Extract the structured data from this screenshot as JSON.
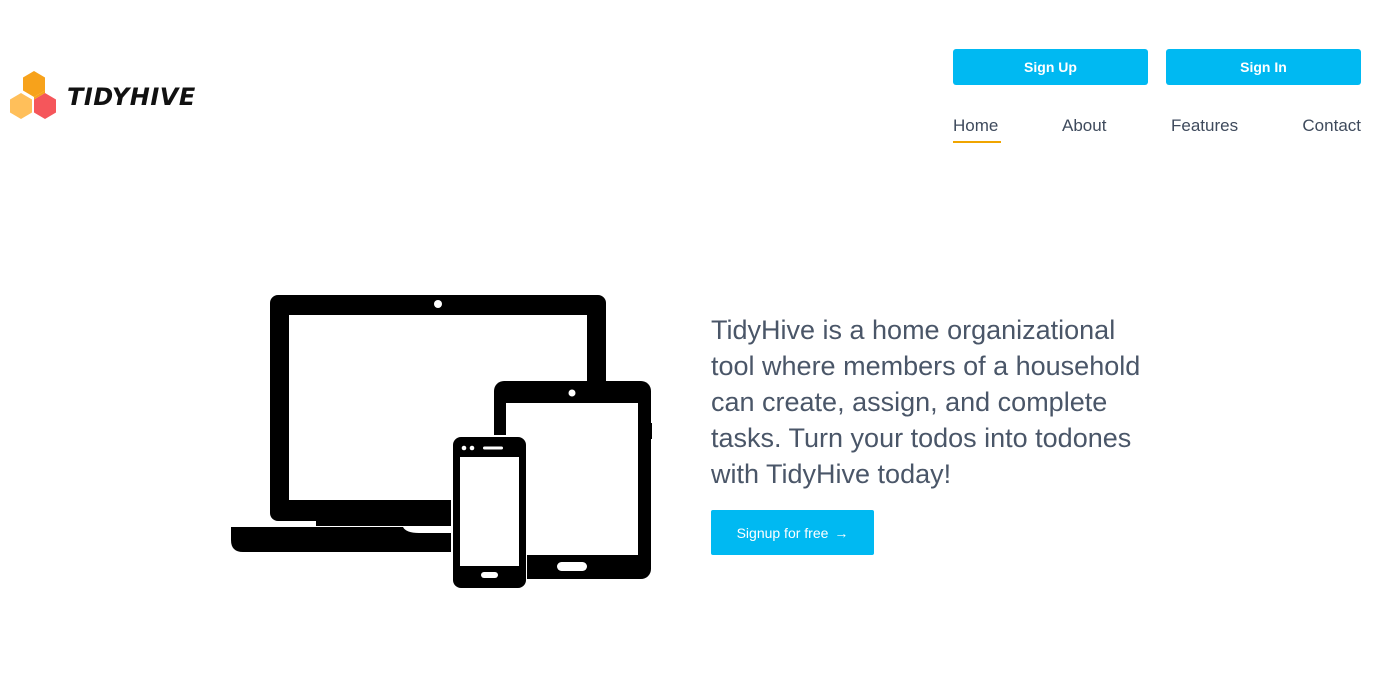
{
  "brand": {
    "name": "TIDYHIVE",
    "hex_colors": [
      "#f7a21b",
      "#ffbf5a",
      "#f5565b"
    ]
  },
  "header": {
    "signup_label": "Sign Up",
    "signin_label": "Sign In",
    "button_color": "#00b9f2"
  },
  "nav": {
    "items": [
      {
        "label": "Home",
        "active": true
      },
      {
        "label": "About",
        "active": false
      },
      {
        "label": "Features",
        "active": false
      },
      {
        "label": "Contact",
        "active": false
      }
    ],
    "active_underline_color": "#f0a500"
  },
  "hero": {
    "description": "TidyHive is a home organizational tool where members of a household can create, assign, and complete tasks. Turn your todos into todones with TidyHive today!",
    "cta_label": "Signup for free",
    "cta_icon": "arrow-right-icon",
    "illustration_icon": "devices-icon"
  }
}
